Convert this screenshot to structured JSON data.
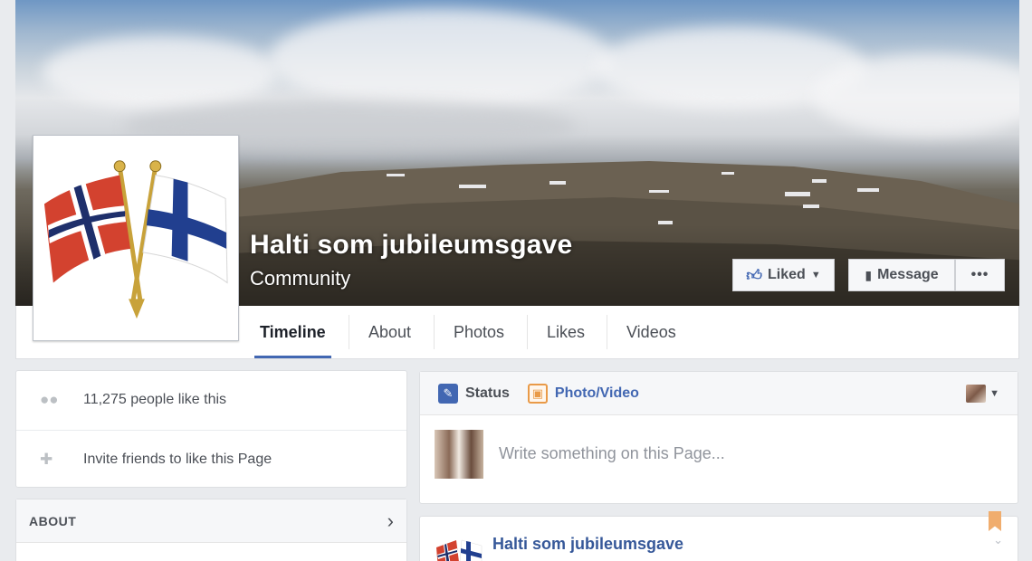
{
  "page": {
    "name": "Halti som jubileumsgave",
    "category": "Community"
  },
  "actions": {
    "liked_label": "Liked",
    "message_label": "Message",
    "more_label": "•••"
  },
  "tabs": [
    {
      "label": "Timeline"
    },
    {
      "label": "About"
    },
    {
      "label": "Photos"
    },
    {
      "label": "Likes"
    },
    {
      "label": "Videos"
    }
  ],
  "sidebar": {
    "likes_text": "11,275 people like this",
    "invite_text": "Invite friends to like this Page",
    "about_heading": "ABOUT"
  },
  "composer": {
    "status_label": "Status",
    "photo_label": "Photo/Video",
    "placeholder": "Write something on this Page..."
  },
  "post": {
    "author": "Halti som jubileumsgave"
  },
  "colors": {
    "accent": "#4267b2",
    "link": "#365899",
    "background": "#e9ebee"
  }
}
